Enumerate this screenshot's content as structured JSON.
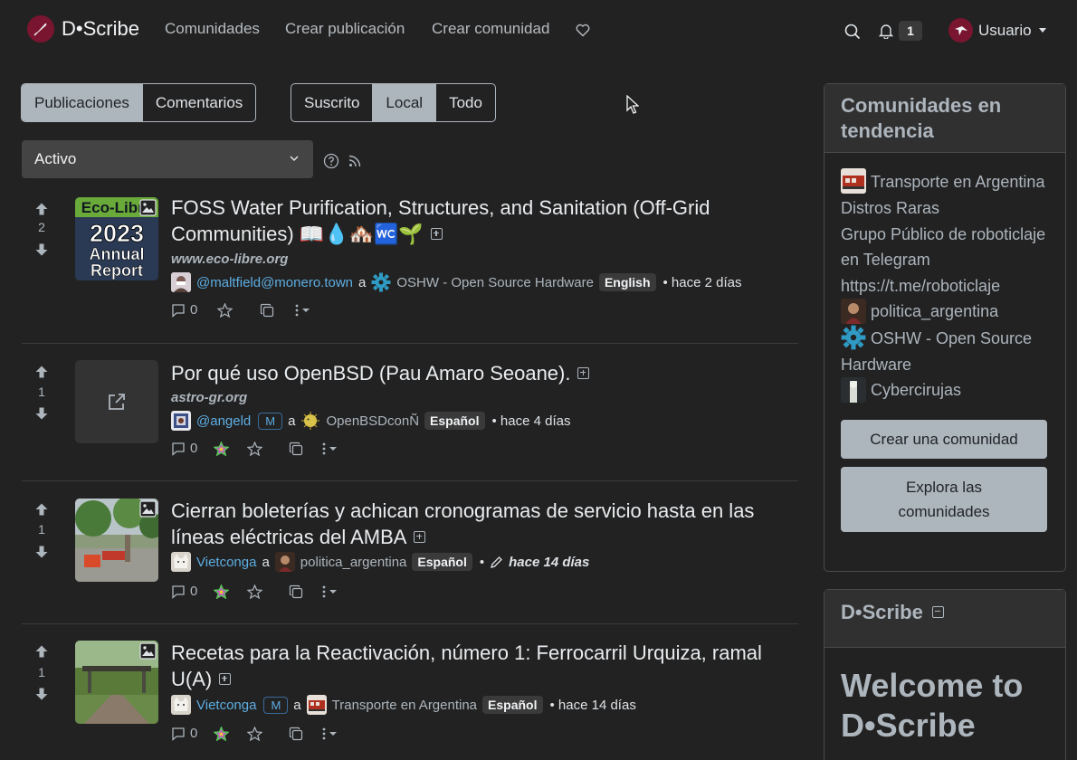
{
  "nav": {
    "brand": "D•Scribe",
    "links": [
      "Comunidades",
      "Crear publicación",
      "Crear comunidad"
    ],
    "notifications_count": "1",
    "user_label": "Usuario"
  },
  "listing": {
    "type_tabs": [
      "Publicaciones",
      "Comentarios"
    ],
    "type_active": "Publicaciones",
    "scope_tabs": [
      "Suscrito",
      "Local",
      "Todo"
    ],
    "scope_active": "Local",
    "sort_value": "Activo"
  },
  "posts": [
    {
      "title": "FOSS Water Purification, Structures, and Sanitation (Off-Grid Communities) 📖💧🏘️🚾🌱",
      "score": "2",
      "domain": "www.eco-libre.org",
      "author": "@maltfield@monero.town",
      "mod": "",
      "connector": "a",
      "community": "OSHW - Open Source Hardware",
      "language": "English",
      "time": "• hace 2 días",
      "comments": "0",
      "thumb": {
        "line1": "Eco-Libre",
        "line2": "2023",
        "line3": "Annual",
        "line4": "Report"
      }
    },
    {
      "title": "Por qué uso OpenBSD (Pau Amaro Seoane).",
      "score": "1",
      "domain": "astro-gr.org",
      "author": "@angeld",
      "mod": "M",
      "connector": "a",
      "community": "OpenBSDconÑ",
      "language": "Español",
      "time": "• hace 4 días",
      "comments": "0"
    },
    {
      "title": "Cierran boleterías y achican cronogramas de servicio hasta en las líneas eléctricas del AMBA",
      "score": "1",
      "domain": "",
      "author": "Vietconga",
      "mod": "",
      "connector": "a",
      "community": "politica_argentina",
      "language": "Español",
      "time_prefix": "•",
      "time": "hace 14 días",
      "comments": "0"
    },
    {
      "title": "Recetas para la Reactivación, número 1: Ferrocarril Urquiza, ramal U(A)",
      "score": "1",
      "domain": "",
      "author": "Vietconga",
      "mod": "M",
      "connector": "a",
      "community": "Transporte en Argentina",
      "language": "Español",
      "time": "• hace 14 días",
      "comments": "0"
    }
  ],
  "sidebar": {
    "trending_title": "Comunidades en tendencia",
    "trending": [
      "Transporte en Argentina",
      "Distros Raras",
      "Grupo Público de roboticlaje en Telegram https://t.me/roboticlaje",
      "politica_argentina",
      "OSHW - Open Source Hardware",
      "Cybercirujas"
    ],
    "create_btn": "Crear una comunidad",
    "explore_btn": "Explora las comunidades",
    "site_title": "D•Scribe",
    "welcome": "Welcome to D•Scribe"
  },
  "colors": {
    "background": "#222222",
    "accent_link": "#5dade2",
    "button_light": "#adb5bd",
    "brand": "#7a1530"
  }
}
